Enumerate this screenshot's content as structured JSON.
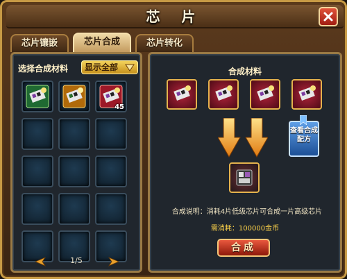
{
  "window": {
    "title": "芯 片"
  },
  "tabs": [
    {
      "label": "芯片镶嵌",
      "active": false
    },
    {
      "label": "芯片合成",
      "active": true
    },
    {
      "label": "芯片转化",
      "active": false
    }
  ],
  "left": {
    "header": "选择合成材料",
    "filter_label": "显示全部",
    "slots": [
      {
        "icon": "green-chip-icon",
        "count": ""
      },
      {
        "icon": "orange-chip-icon",
        "count": ""
      },
      {
        "icon": "red-chip-icon",
        "count": "45"
      }
    ],
    "pager": {
      "page": "1/5"
    }
  },
  "right": {
    "title": "合成材料",
    "materials": [
      "red-chip-icon",
      "red-chip-icon",
      "red-chip-icon",
      "red-chip-icon"
    ],
    "recipe_label": "查看合成配方",
    "result_icon": "dark-chip-icon",
    "description": "合成说明：消耗4片低级芯片可合成一片高级芯片",
    "cost": "需消耗：100000金币",
    "compose_label": "合成"
  },
  "colors": {
    "accent_gold": "#c79a45",
    "panel_bg": "#20262d",
    "red_button": "#b8260e",
    "blue_button": "#2d6bc0",
    "cost_yellow": "#ffd44a"
  }
}
